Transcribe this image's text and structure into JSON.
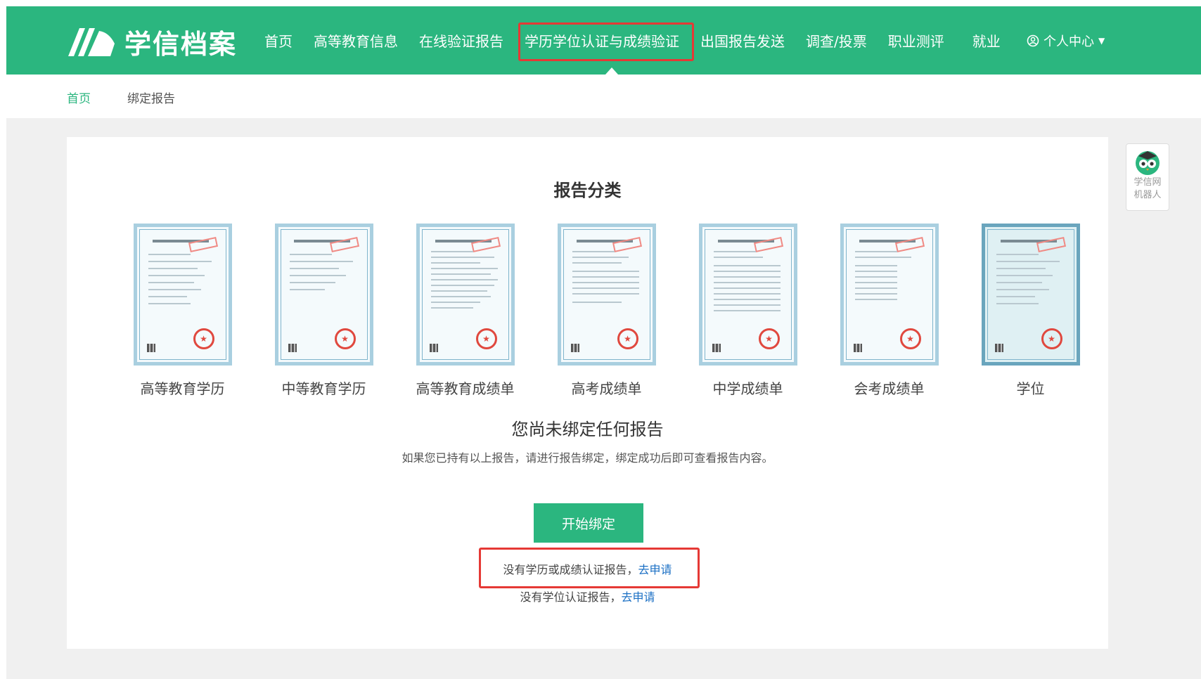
{
  "app": {
    "logo_text": "学信档案"
  },
  "nav": {
    "items": [
      "首页",
      "高等教育信息",
      "在线验证报告",
      "学历学位认证与成绩验证",
      "出国报告发送",
      "调查/投票",
      "职业测评",
      "就业"
    ],
    "active_index": 3,
    "user_label": "个人中心"
  },
  "breadcrumb": {
    "home": "首页",
    "current": "绑定报告"
  },
  "reports": {
    "title": "报告分类",
    "items": [
      {
        "label": "高等教育学历"
      },
      {
        "label": "中等教育学历"
      },
      {
        "label": "高等教育成绩单"
      },
      {
        "label": "高考成绩单"
      },
      {
        "label": "中学成绩单"
      },
      {
        "label": "会考成绩单"
      },
      {
        "label": "学位"
      }
    ]
  },
  "empty": {
    "title": "您尚未绑定任何报告",
    "desc": "如果您已持有以上报告，请进行报告绑定，绑定成功后即可查看报告内容。",
    "bind_button": "开始绑定",
    "apply1_text": "没有学历或成绩认证报告，",
    "apply1_link": "去申请",
    "apply2_text": "没有学位认证报告，",
    "apply2_link": "去申请"
  },
  "robot": {
    "label": "学信网机器人"
  },
  "colors": {
    "brand": "#2bb67f",
    "link": "#1a6fc4",
    "highlight": "#e53935"
  },
  "icons": {
    "logo": "book-wing-logo-icon",
    "user": "user-circle-icon",
    "robot": "robot-owl-icon"
  }
}
